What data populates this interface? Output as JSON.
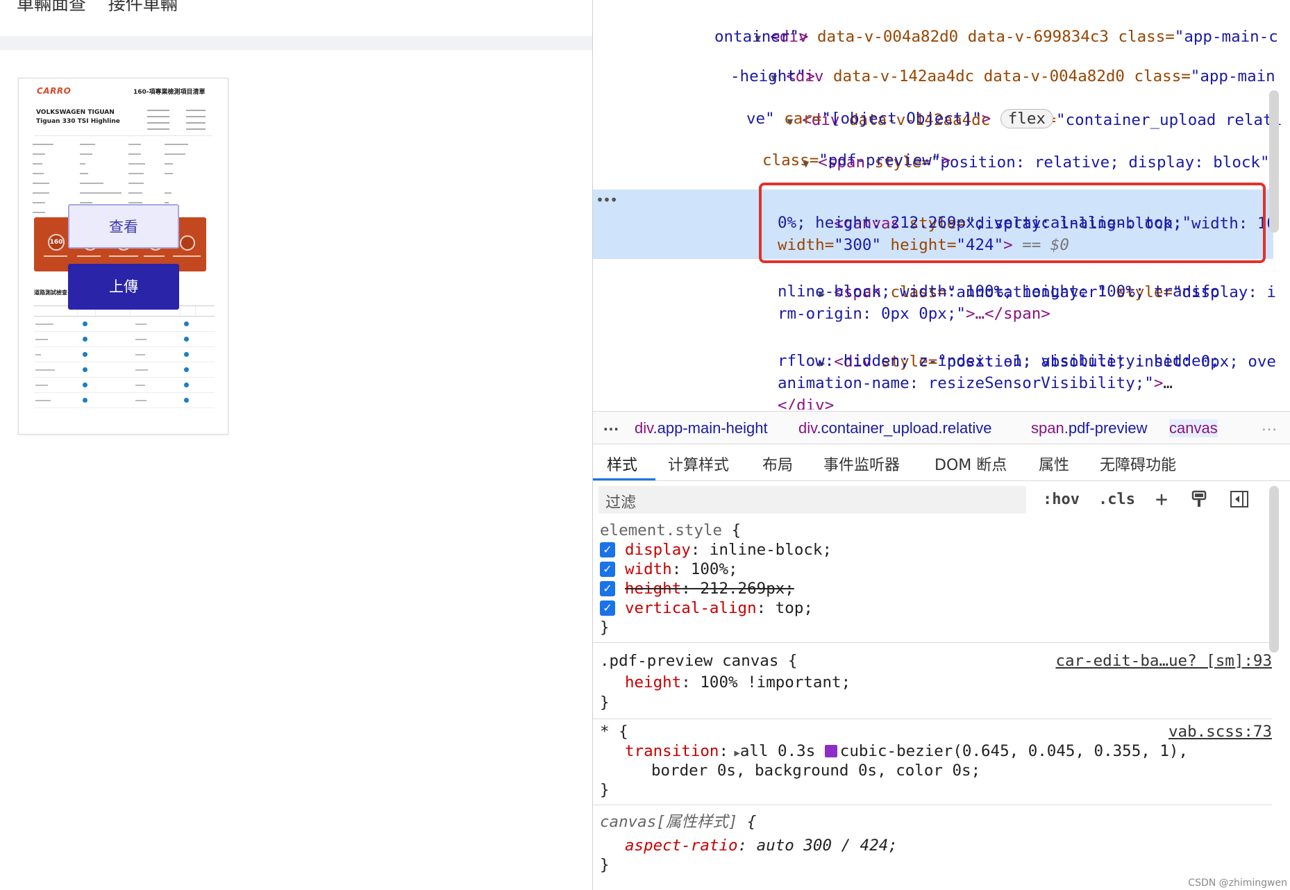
{
  "app": {
    "header_partial_text": "車輛面查    接件車輛",
    "pdf_preview": {
      "brand": "CARRO",
      "title": "160-項專業檢測項目清單",
      "car_line1": "VOLKSWAGEN TIGUAN",
      "car_line2": "Tiguan 330 TSI Highline",
      "badge_number": "160",
      "section_title": "道路測試檢查"
    },
    "view_button": "查看",
    "upload_button": "上傳"
  },
  "devtools": {
    "dom": {
      "line1": {
        "tag_open": "<div",
        "attr1": " data-v-004a82d0",
        "attr2": " data-v-699834c3",
        "class_attr": " class=",
        "class_val": "\"app-main-c"
      },
      "line1b": "ontainer\"",
      "line2": {
        "tag_open": "<div",
        "attr1": " data-v-142aa4dc",
        "attr2": " data-v-004a82d0",
        "class_attr": " class=",
        "class_val": "\"app-main"
      },
      "line2b": "-height\"",
      "line3": {
        "tag_open": "<div",
        "attr1": " data-v-142aa4dc",
        "class_attr": " class=",
        "class_val": "\"container_upload relati"
      },
      "line3b_val": "ve\"",
      "line3b_attr": " car=",
      "line3b_val2": "\"[object Object]\"",
      "flex_pill": "flex",
      "line4": {
        "tag_open": "<span",
        "attr": " style=",
        "val": "\"position: relative; display: block\""
      },
      "line4b_attr": "class=",
      "line4b_val": "\"pdf-preview\"",
      "selected": {
        "tag_open": "<canvas",
        "style_attr": " style=",
        "style_val1": "\"display: inline-block; width: 10",
        "style_val2": "0%; height: 212.269px; vertical-align: top;\"",
        "width_attr": "width=",
        "width_val": "\"300\"",
        "height_attr": " height=",
        "height_val": "\"424\"",
        "suffix": " == ",
        "dollar": "$0"
      },
      "line6": {
        "tag_open": "<span",
        "class_attr": " class=",
        "class_val": "\"annotationLayer\"",
        "style_attr": " style=",
        "style_val1": "\"display: i"
      },
      "line6b": "nline-block; width: 100%; height: 100%; transfo",
      "line6c": "rm-origin: 0px 0px;\"",
      "line6c_end": "…</span>",
      "line7": {
        "tag_open": "<div",
        "style_attr": " style=",
        "style_val1": "\"position: absolute; inset: 0px; ove"
      },
      "line7b": "rflow: hidden; z-index: -1; visibility: hidden;",
      "line7c": "animation-name: resizeSensorVisibility;\"",
      "line7c_end": "…",
      "line8": "</div>"
    },
    "breadcrumbs": [
      {
        "tag": "div",
        "cls": ".app-main-height"
      },
      {
        "tag": "div",
        "cls": ".container_upload.relative"
      },
      {
        "tag": "span",
        "cls": ".pdf-preview"
      },
      {
        "tag": "canvas",
        "cls": ""
      }
    ],
    "tabs": [
      "样式",
      "计算样式",
      "布局",
      "事件监听器",
      "DOM 断点",
      "属性",
      "无障碍功能"
    ],
    "filter_placeholder": "过滤",
    "toolbar": {
      "hov": ":hov",
      "cls": ".cls",
      "plus": "+"
    },
    "rules": {
      "element_style": {
        "selector": "element.style",
        "props": [
          {
            "name": "display",
            "value": "inline-block;"
          },
          {
            "name": "width",
            "value": "100%;"
          },
          {
            "name": "height",
            "value": " 212.269px;"
          },
          {
            "name": "vertical-align",
            "value": "top;"
          }
        ]
      },
      "pdf_canvas": {
        "selector": ".pdf-preview canvas",
        "source": "car-edit-ba…ue? [sm]:93",
        "prop": "height",
        "value": "100% !important;"
      },
      "universal": {
        "selector": "*",
        "source": "vab.scss:73",
        "prop": "transition",
        "value1": "all 0.3s ",
        "value1b": "cubic-bezier(0.645, 0.045, 0.355, 1),",
        "value2": "border 0s, background 0s, color 0s;"
      },
      "canvas_attr": {
        "selector": "canvas[属性样式]",
        "prop": "aspect-ratio",
        "value": "auto 300 / 424;"
      }
    },
    "watermark": "CSDN @zhimingwen"
  }
}
